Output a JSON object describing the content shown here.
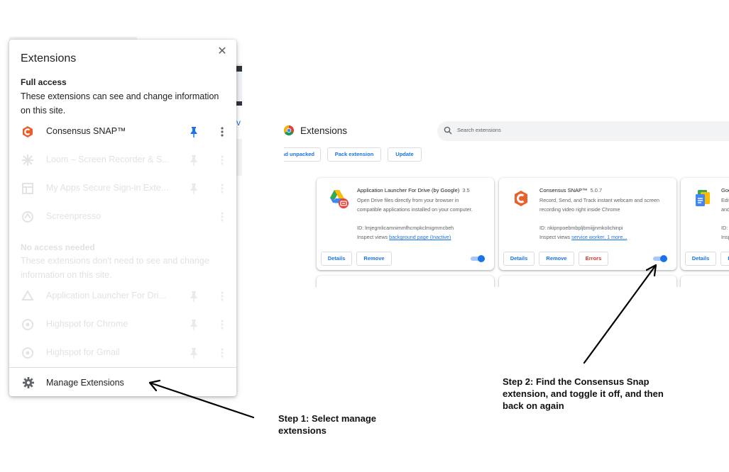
{
  "popup": {
    "title": "Extensions",
    "full_access": {
      "heading": "Full access",
      "description": "These extensions can see and change information on this site.",
      "items": [
        {
          "name": "Consensus SNAP™",
          "icon": "consensus-snap-icon"
        },
        {
          "name": "Loom – Screen Recorder & S...",
          "icon": "loom-icon"
        },
        {
          "name": "My Apps Secure Sign-in Exte...",
          "icon": "my-apps-icon"
        },
        {
          "name": "Screenpresso",
          "icon": "screenpresso-icon"
        }
      ]
    },
    "no_access": {
      "heading": "No access needed",
      "description": "These extensions don't need to see and change information on this site.",
      "items": [
        {
          "name": "Application Launcher For Dri...",
          "icon": "drive-launcher-icon"
        },
        {
          "name": "Highspot for Chrome",
          "icon": "highspot-icon"
        },
        {
          "name": "Highspot for Gmail",
          "icon": "highspot-icon"
        }
      ]
    },
    "manage_label": "Manage Extensions"
  },
  "page": {
    "title": "Extensions",
    "search_placeholder": "Search extensions",
    "toolbar": {
      "load_unpacked": "Load unpacked",
      "pack": "Pack extension",
      "update": "Update"
    },
    "cards": [
      {
        "name": "Application Launcher For Drive (by Google)",
        "version": "3.5",
        "description": "Open Drive files directly from your browser in compatible applications installed on your computer.",
        "id": "ID: lmjegmlicamnimmfhcmpkclmigmmcbeh",
        "inspect_prefix": "Inspect views",
        "inspect_link": "background page (Inactive)",
        "details": "Details",
        "remove": "Remove",
        "enabled": true
      },
      {
        "name": "Consensus SNAP™",
        "version": "5.0.7",
        "description": "Record, Send, and Track instant webcam and screen recording video right inside Chrome",
        "id": "ID: nkipnpoebmbpljbmiijjnmkolichinpi",
        "inspect_prefix": "Inspect views",
        "inspect_link": "service worker, 1 more...",
        "details": "Details",
        "remove": "Remove",
        "errors": "Errors",
        "enabled": true
      },
      {
        "name": "Google Docs Offline",
        "version": "",
        "description": "Edit, create, and view your documents, spreadsheets, and presentations — all without internet access.",
        "id": "ID: ghbmnnjooekpmoecnnnilnnbdlolhkhi",
        "inspect_prefix": "Inspect views",
        "inspect_link": "",
        "details": "Details",
        "remove": "Remove",
        "enabled": true
      }
    ]
  },
  "annotations": {
    "step1": "Step 1: Select manage extensions",
    "step2": "Step 2: Find the Consensus Snap extension, and toggle it off, and then back on again"
  },
  "colors": {
    "accent": "#1a73e8",
    "error": "#d93025",
    "consensus": "#e8612c"
  }
}
